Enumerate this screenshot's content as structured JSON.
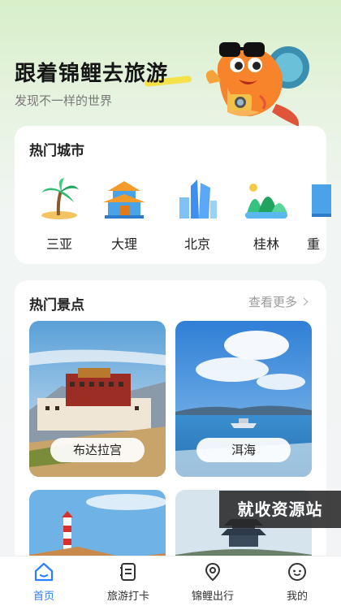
{
  "hero": {
    "title": "跟着锦鲤去旅游",
    "subtitle": "发现不一样的世界"
  },
  "hot_cities": {
    "title": "热门城市",
    "items": [
      {
        "name": "三亚",
        "icon": "palm-tree-icon"
      },
      {
        "name": "大理",
        "icon": "pavilion-icon"
      },
      {
        "name": "北京",
        "icon": "skyscraper-icon"
      },
      {
        "name": "桂林",
        "icon": "mountain-icon"
      },
      {
        "name": "重",
        "icon": "building-icon"
      }
    ]
  },
  "hot_spots": {
    "title": "热门景点",
    "more": "查看更多",
    "items": [
      {
        "name": "布达拉宫"
      },
      {
        "name": "洱海"
      }
    ]
  },
  "watermark": "就收资源站",
  "tabbar": {
    "items": [
      {
        "label": "首页",
        "icon": "home-icon",
        "active": true
      },
      {
        "label": "旅游打卡",
        "icon": "checkin-icon",
        "active": false
      },
      {
        "label": "锦鲤出行",
        "icon": "location-icon",
        "active": false
      },
      {
        "label": "我的",
        "icon": "profile-icon",
        "active": false
      }
    ]
  },
  "colors": {
    "accent": "#2b7fff",
    "highlight": "#f5e14a"
  }
}
